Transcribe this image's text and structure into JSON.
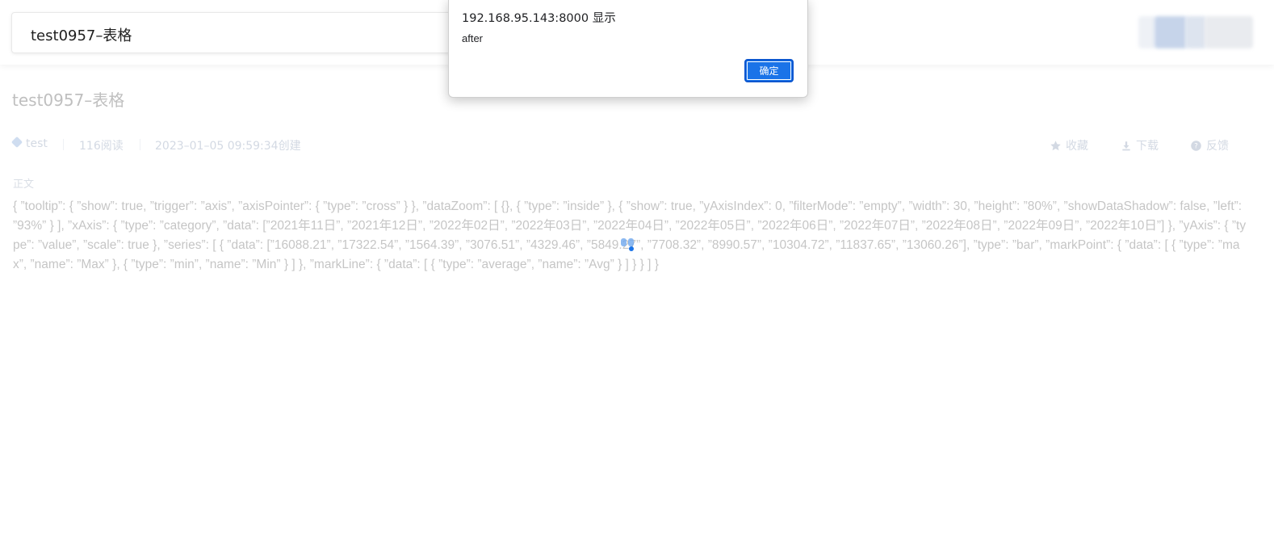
{
  "header": {
    "title_input": "test0957–表格"
  },
  "article": {
    "title": "test0957–表格",
    "meta": {
      "tag": "test",
      "reads": "116阅读",
      "created": "2023–01–05 09:59:34创建"
    },
    "actions": {
      "favorite": "收藏",
      "download": "下载",
      "feedback": "反馈"
    },
    "section_label": "正文",
    "body": "{ ”tooltip”: { ”show”: true, ”trigger”: ”axis”, ”axisPointer”: { ”type”: ”cross” } }, ”dataZoom”: [ {}, { ”type”: ”inside” }, { ”show”: true, ”yAxisIndex”: 0, ”filterMode”: ”empty”, ”width”: 30, ”height”: ”80%”, ”showDataShadow”: false, ”left”: ”93%” } ], ”xAxis”: { ”type”: ”category”, ”data”: [”2021年11日”, ”2021年12日”, ”2022年02日”, ”2022年03日”, ”2022年04日”, ”2022年05日”, ”2022年06日”, ”2022年07日”, ”2022年08日”, ”2022年09日”, ”2022年10日”] }, ”yAxis”: { ”type”: ”value”, ”scale”: true }, ”series”: [ { ”data”: [”16088.21”, ”17322.54”, ”1564.39”, ”3076.51”, ”4329.46”, ”5849.27”, ”7708.32”, ”8990.57”, ”10304.72”, ”11837.65”, ”13060.26”], ”type”: ”bar”, ”markPoint”: { ”data”: [ { ”type”: ”max”, ”name”: ”Max” }, { ”type”: ”min”, ”name”: ”Min” } ] }, ”markLine”: { ”data”: [ { ”type”: ”average”, ”name”: ”Avg” } ] } } ] }"
  },
  "dialog": {
    "origin": "192.168.95.143:8000 显示",
    "message": "after",
    "ok_label": "确定"
  },
  "colors": {
    "accent": "#1a73e8",
    "meta_text": "#8a9bb5"
  }
}
